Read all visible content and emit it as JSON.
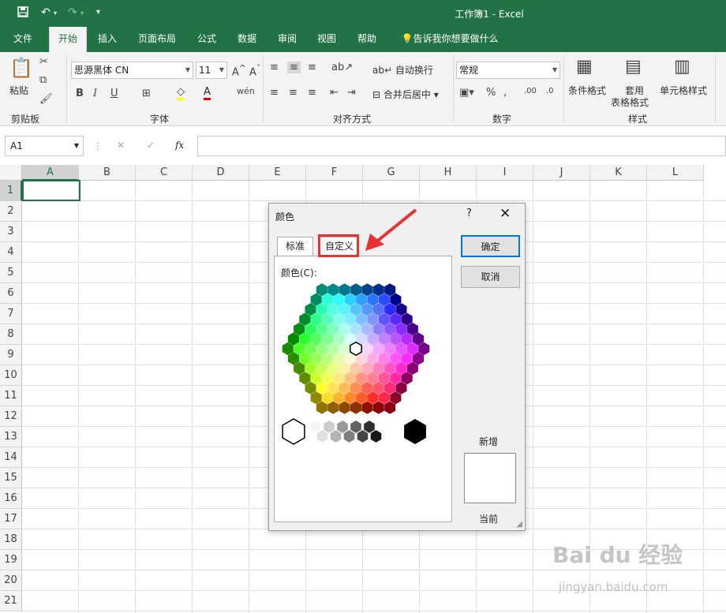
{
  "titlebar": {
    "title": "工作簿1  -  Excel"
  },
  "ribbon_tabs": [
    "文件",
    "开始",
    "插入",
    "页面布局",
    "公式",
    "数据",
    "审阅",
    "视图",
    "帮助"
  ],
  "tell_me": "告诉我你想要做什么",
  "ribbon": {
    "paste": "粘贴",
    "clipboard_label": "剪贴板",
    "font_name": "思源黑体 CN",
    "font_size": "11",
    "font_label": "字体",
    "bold": "B",
    "italic": "I",
    "underline": "U",
    "wrap_text": "自动换行",
    "merge_center": "合并后居中",
    "alignment_label": "对齐方式",
    "number_format": "常规",
    "number_label": "数字",
    "conditional_format": "条件格式",
    "format_table_1": "套用",
    "format_table_2": "表格格式",
    "cell_styles": "单元格样式",
    "styles_label": "样式"
  },
  "formula": {
    "name_box": "A1",
    "fx": "fx"
  },
  "columns": [
    "A",
    "B",
    "C",
    "D",
    "E",
    "F",
    "G",
    "H",
    "I",
    "J",
    "K",
    "L"
  ],
  "rows": [
    "1",
    "2",
    "3",
    "4",
    "5",
    "6",
    "7",
    "8",
    "9",
    "10",
    "11",
    "12",
    "13",
    "14",
    "15",
    "16",
    "17",
    "18",
    "19",
    "20",
    "21"
  ],
  "dialog": {
    "title": "颜色",
    "help": "?",
    "tab_standard": "标准",
    "tab_custom": "自定义",
    "colors_label": "颜色(C):",
    "ok": "确定",
    "cancel": "取消",
    "new_label": "新增",
    "current_label": "当前"
  },
  "watermark": {
    "brand": "Bai du 经验",
    "url": "jingyan.baidu.com"
  },
  "colors": {
    "excel_green": "#217346",
    "highlight_red": "#e53333",
    "arrow_red": "#e53333"
  }
}
